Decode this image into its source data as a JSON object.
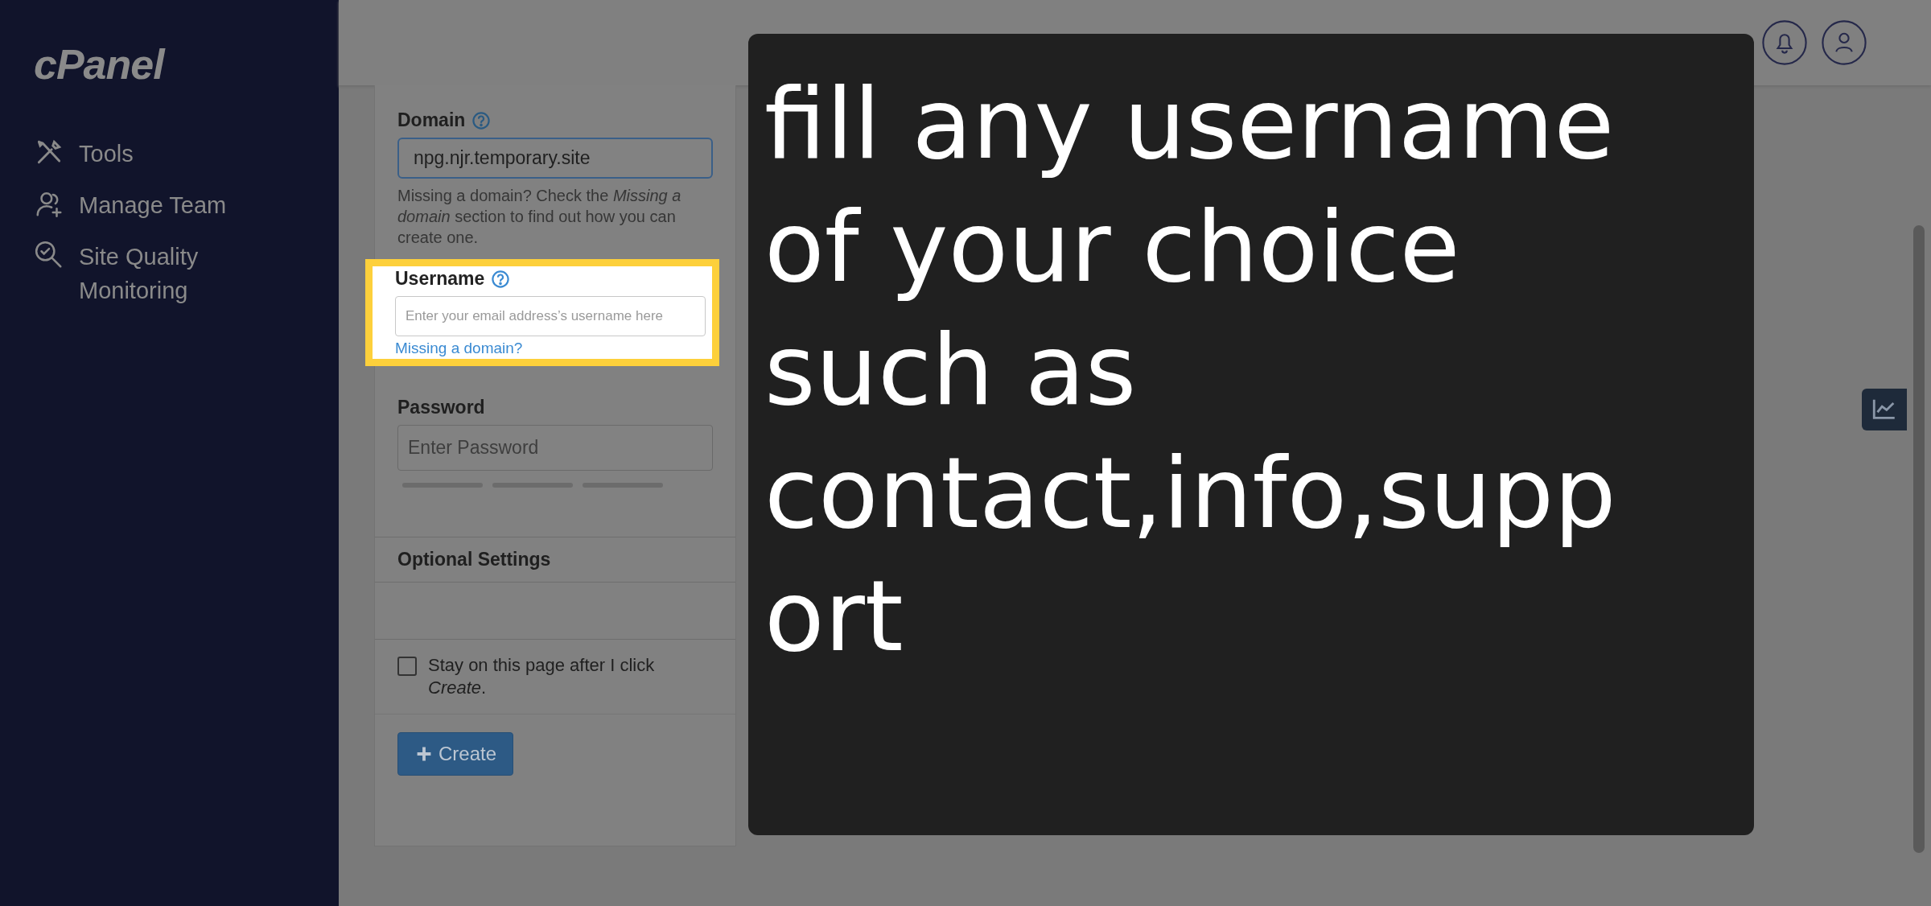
{
  "sidebar": {
    "logo": "cPanel",
    "items": [
      {
        "label": "Tools"
      },
      {
        "label": "Manage Team"
      },
      {
        "label": "Site Quality Monitoring"
      }
    ]
  },
  "form": {
    "domain": {
      "label": "Domain",
      "value": "npg.njr.temporary.site",
      "help": "Missing a domain? Check the *Missing a domain* section to find out how you can create one."
    },
    "username": {
      "label": "Username",
      "placeholder": "Enter your email address’s username here",
      "link": "Missing a domain?"
    },
    "password": {
      "label": "Password",
      "placeholder": "Enter Password"
    },
    "optional_settings": {
      "title": "Optional Settings"
    },
    "stay_on_page": {
      "label": "Stay on this page after I click *Create*.",
      "checked": false
    },
    "create_button": "Create"
  },
  "callout": {
    "text": "fill any username of your choice such as contact,info,support"
  }
}
